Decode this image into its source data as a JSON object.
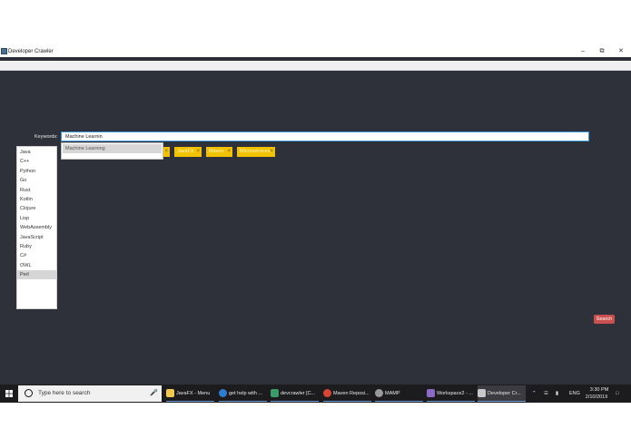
{
  "window": {
    "title": "Developer Crawler",
    "minimize_glyph": "–",
    "restore_glyph": "⧉",
    "close_glyph": "✕"
  },
  "keywords": {
    "label": "Keywords:",
    "value": "Machine Learnin"
  },
  "suggestions": [
    "Machine Learning"
  ],
  "tags": [
    {
      "label": "",
      "remove": "×"
    },
    {
      "label": "JavaFX",
      "remove": "×"
    },
    {
      "label": "Maven",
      "remove": "×"
    },
    {
      "label": "Microservices",
      "remove": "×"
    }
  ],
  "languages": {
    "items": [
      "Java",
      "C++",
      "Python",
      "Go",
      "Rust",
      "Kotlin",
      "Clojure",
      "Lisp",
      "WebAssembly",
      "JavaScript",
      "Ruby",
      "C#",
      "OWL",
      "Perl"
    ],
    "selected": "Perl"
  },
  "search_button": "Search",
  "taskbar": {
    "search_placeholder": "Type here to search",
    "tasks": [
      {
        "label": "JavaFX - Menu",
        "icon": "file-explorer-icon",
        "color": "#f2c94c"
      },
      {
        "label": "get help with ...",
        "icon": "edge-icon",
        "color": "#2f7bd1"
      },
      {
        "label": "devcrawler [C...",
        "icon": "intellij-icon",
        "color": "#3a9a6a"
      },
      {
        "label": "Maven Reposi...",
        "icon": "chrome-icon",
        "color": "#d64536"
      },
      {
        "label": "MAMP",
        "icon": "mamp-icon",
        "color": "#9a9a9a"
      },
      {
        "label": "Workspace2 - ...",
        "icon": "sublime-icon",
        "color": "#8a6ac4"
      },
      {
        "label": "Developer Cr...",
        "icon": "java-icon",
        "color": "#c8c8c8"
      }
    ],
    "language": "ENG",
    "time": "3:30 PM",
    "date": "2/10/2019"
  },
  "colors": {
    "content_bg": "#2e313a",
    "tag_bg": "#f2c200",
    "search_button_bg": "#c9504f",
    "input_border": "#3a9bd9",
    "taskbar_bg": "#1c1c1f"
  }
}
